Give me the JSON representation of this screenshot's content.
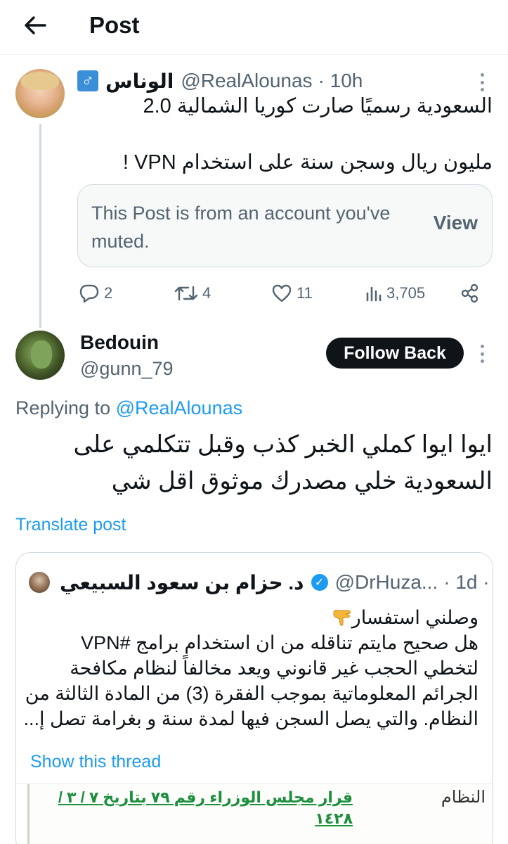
{
  "header": {
    "title": "Post"
  },
  "post1": {
    "badge": "♂",
    "name": "الوناس",
    "handle": "@RealAlounas",
    "time": "· 10h",
    "line1": "السعودية رسميًا صارت كوريا الشمالية 2.0",
    "line2": "مليون ريال وسجن سنة على استخدام VPN !",
    "muted_text": "This Post is from an account you've muted.",
    "muted_action": "View",
    "stats": {
      "replies": "2",
      "reposts": "4",
      "likes": "11",
      "views": "3,705"
    }
  },
  "post2": {
    "name": "Bedouin",
    "handle": "@gunn_79",
    "follow_label": "Follow Back",
    "replying_prefix": "Replying to ",
    "replying_to": "@RealAlounas",
    "text_line1": "ايوا ايوا كملي الخبر كذب وقبل تتكلمي على",
    "text_line2": "السعودية خلي مصدرك موثوق اقل شي",
    "translate": "Translate post"
  },
  "quoted": {
    "name": "د. حزام بن سعود السبيعي",
    "handle": "@DrHuza...",
    "time": "· 1d ·",
    "line1": "وصلني استفسار",
    "line2": "هل صحيح مايتم تناقله من ان استخدام برامج #VPN",
    "line3": "لتخطي الحجب غير قانوني ويعد مخالفاً لنظام مكافحة",
    "line4": "الجرائم المعلوماتية بموجب الفقرة (3) من المادة الثالثة من",
    "line5": "النظام. والتي يصل السجن فيها لمدة سنة و بغرامة تصل إ...",
    "show_thread": "Show this thread",
    "image_label_right": "النظام",
    "image_label_left": "قرار مجلس الوزراء رقم ٧٩ بتاريخ ٧ / ٣ / ١٤٢٨"
  },
  "colors": {
    "link": "#1d9bf0",
    "muted": "#536471",
    "border": "#cfd9de",
    "button_bg": "#0f1419"
  }
}
